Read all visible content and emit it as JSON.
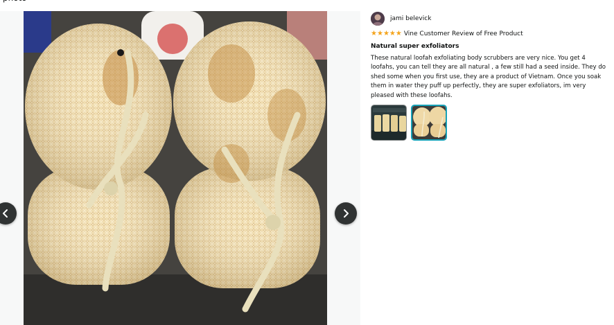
{
  "page": {
    "top_fragment": "photo"
  },
  "review": {
    "author": "jami belevick",
    "rating": 5,
    "rating_max": 5,
    "vine_label": "Vine Customer Review of Free Product",
    "title": "Natural super exfoliators",
    "body": "These natural loofah exfoliating body scrubbers are very nice. You get 4 loofahs, you can tell they are all natural , a few still had a seed inside. They do shed some when you first use, they are a product of Vietnam. Once you soak them in water they puff up perfectly, they are super exfoliators, im very pleased with these loofahs."
  },
  "viewer": {
    "prev_icon": "chevron-left-icon",
    "next_icon": "chevron-right-icon",
    "thumbnails": [
      {
        "name": "thumbnail-1",
        "selected": false
      },
      {
        "name": "thumbnail-2",
        "selected": true
      }
    ]
  },
  "colors": {
    "star": "#f4a41c",
    "selected_thumb_border": "#17a2b8",
    "nav_button_bg": "#303333"
  }
}
